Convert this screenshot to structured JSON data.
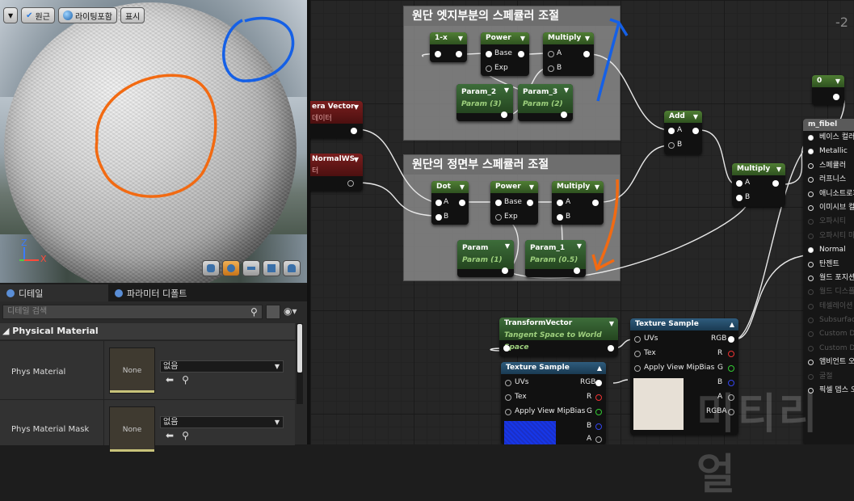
{
  "viewport": {
    "toolbar": {
      "menu_icon": "chevron-down-icon",
      "perspective_label": "원근",
      "lit_label": "라이팅포함",
      "show_label": "표시"
    },
    "axis": {
      "z": "Z",
      "x": "X"
    }
  },
  "details": {
    "tabs": [
      {
        "label": "디테일"
      },
      {
        "label": "파라미터 디폴트"
      }
    ],
    "search_placeholder": "디테일 검색",
    "section": "Physical Material",
    "props": [
      {
        "label": "Phys Material",
        "thumb": "None",
        "value": "없음"
      },
      {
        "label": "Phys Material Mask",
        "thumb": "None",
        "value": "없음"
      }
    ]
  },
  "graph": {
    "comments": [
      {
        "title": "원단 엣지부분의 스페큘러 조절"
      },
      {
        "title": "원단의 정면부 스페큘러 조절"
      }
    ],
    "nodes": {
      "one_minus_x": "1-x",
      "power1": "Power",
      "multiply1": "Multiply",
      "base": "Base",
      "exp": "Exp",
      "a": "A",
      "b": "B",
      "param2": {
        "title": "Param_2",
        "sub": "Param (3)"
      },
      "param3": {
        "title": "Param_3",
        "sub": "Param (2)"
      },
      "dot": "Dot",
      "power2": "Power",
      "multiply2": "Multiply",
      "param": {
        "title": "Param",
        "sub": "Param (1)"
      },
      "param1": {
        "title": "Param_1",
        "sub": "Param (0.5)"
      },
      "add": "Add",
      "multiply3": "Multiply",
      "const0": "0",
      "camera_vector": {
        "title": "era Vector",
        "sub": "데이터"
      },
      "normalws": {
        "title": "NormalWS",
        "sub": "터"
      },
      "transform_vector": {
        "title": "TransformVector",
        "sub": "Tangent Space to World Space"
      },
      "tex1": {
        "title": "Texture Sample",
        "uvs": "UVs",
        "tex": "Tex",
        "mip": "Apply View MipBias",
        "rgb": "RGB",
        "r": "R",
        "g": "G",
        "b": "B",
        "a": "A",
        "rgba": "RGBA"
      },
      "tex2": {
        "title": "Texture Sample",
        "uvs": "UVs",
        "tex": "Tex",
        "mip": "Apply View MipBias",
        "rgb": "RGB",
        "r": "R",
        "g": "G",
        "b": "B",
        "a": "A"
      },
      "result": {
        "title": "m_fibel",
        "pins": [
          {
            "label": "베이스 컬러",
            "state": "con"
          },
          {
            "label": "Metallic",
            "state": "con"
          },
          {
            "label": "스페큘러",
            "state": "on"
          },
          {
            "label": "러프니스",
            "state": "on"
          },
          {
            "label": "애니소트로피",
            "state": "on"
          },
          {
            "label": "이미시브 컬러",
            "state": "on"
          },
          {
            "label": "오파시티",
            "state": "dim"
          },
          {
            "label": "오파시티 마스크",
            "state": "dim"
          },
          {
            "label": "Normal",
            "state": "con"
          },
          {
            "label": "탄젠트",
            "state": "on"
          },
          {
            "label": "월드 포지션",
            "state": "on"
          },
          {
            "label": "월드 디스플레이스",
            "state": "dim"
          },
          {
            "label": "테셀레이션",
            "state": "dim"
          },
          {
            "label": "Subsurface",
            "state": "dim"
          },
          {
            "label": "Custom Data",
            "state": "dim"
          },
          {
            "label": "Custom Data",
            "state": "dim"
          },
          {
            "label": "앰비언트 오클",
            "state": "on"
          },
          {
            "label": "굴절",
            "state": "dim"
          },
          {
            "label": "픽셀 뎁스 오프",
            "state": "on"
          }
        ]
      }
    },
    "zoom_partial": "-2",
    "watermark": "미티리얼"
  }
}
